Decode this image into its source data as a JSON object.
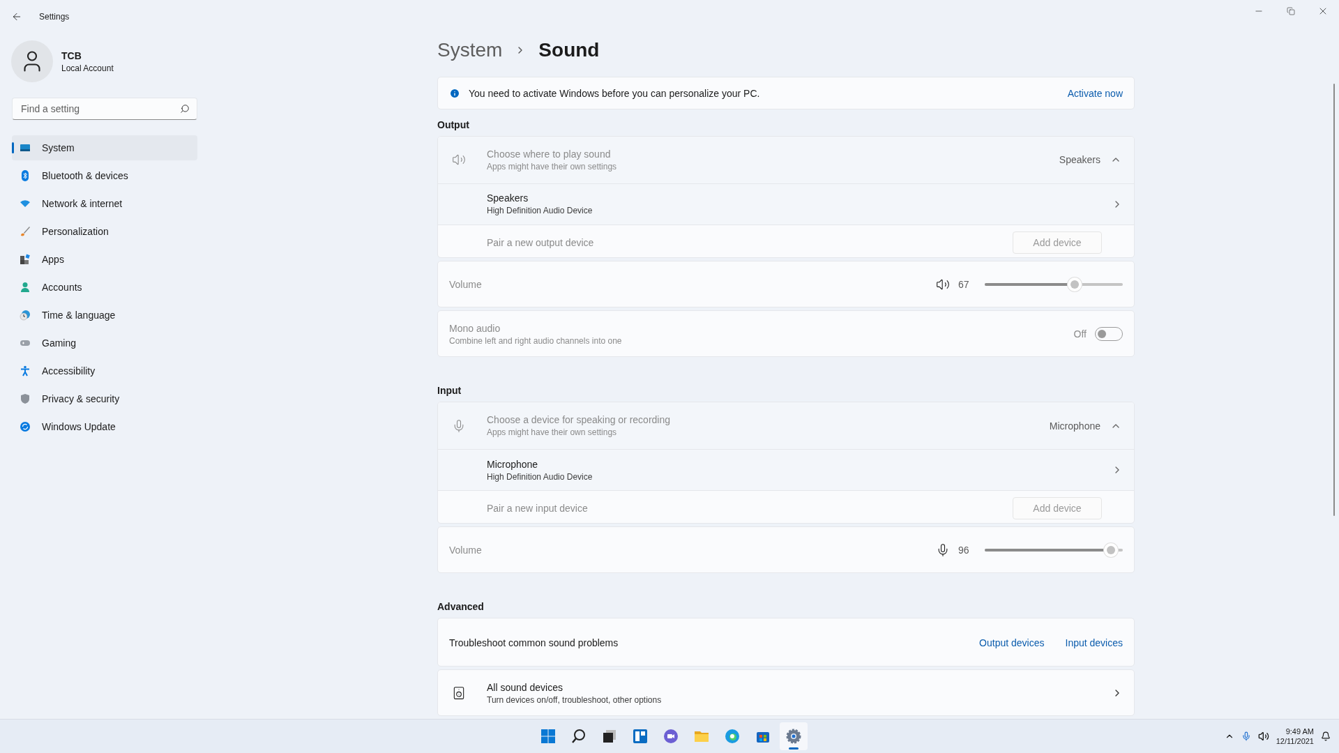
{
  "window": {
    "title": "Settings"
  },
  "account": {
    "name": "TCB",
    "type": "Local Account"
  },
  "search": {
    "placeholder": "Find a setting"
  },
  "nav": [
    {
      "label": "System",
      "kind": "system",
      "selected": true
    },
    {
      "label": "Bluetooth & devices",
      "kind": "bluetooth",
      "selected": false
    },
    {
      "label": "Network & internet",
      "kind": "network",
      "selected": false
    },
    {
      "label": "Personalization",
      "kind": "brush",
      "selected": false
    },
    {
      "label": "Apps",
      "kind": "apps",
      "selected": false
    },
    {
      "label": "Accounts",
      "kind": "accounts",
      "selected": false
    },
    {
      "label": "Time & language",
      "kind": "time",
      "selected": false
    },
    {
      "label": "Gaming",
      "kind": "gaming",
      "selected": false
    },
    {
      "label": "Accessibility",
      "kind": "accessibility",
      "selected": false
    },
    {
      "label": "Privacy & security",
      "kind": "privacy",
      "selected": false
    },
    {
      "label": "Windows Update",
      "kind": "update",
      "selected": false
    }
  ],
  "breadcrumb": [
    "System",
    "Sound"
  ],
  "banner": {
    "message": "You need to activate Windows before you can personalize your PC.",
    "action": "Activate now"
  },
  "sections": [
    {
      "heading": "Output",
      "cards": [
        {
          "kind": "picker",
          "disabled": true,
          "title": "Choose where to play sound",
          "subtitle": "Apps might have their own settings",
          "value": "Speakers",
          "expanded": true,
          "devices": [
            {
              "name": "Speakers",
              "description": "High Definition Audio Device"
            }
          ],
          "pair_label": "Pair a new output device",
          "pair_button": "Add device"
        },
        {
          "kind": "volume",
          "disabled": true,
          "label": "Volume",
          "reading": "67",
          "level": 0.67
        },
        {
          "kind": "toggle",
          "disabled": true,
          "title": "Mono audio",
          "subtitle": "Combine left and right audio channels into one",
          "state_label": "Off",
          "on": false
        }
      ]
    },
    {
      "heading": "Input",
      "cards": [
        {
          "kind": "picker",
          "disabled": true,
          "title": "Choose a device for speaking or recording",
          "subtitle": "Apps might have their own settings",
          "value": "Microphone",
          "expanded": true,
          "devices": [
            {
              "name": "Microphone",
              "description": "High Definition Audio Device"
            }
          ],
          "pair_label": "Pair a new input device",
          "pair_button": "Add device"
        },
        {
          "kind": "volume",
          "disabled": true,
          "label": "Volume",
          "reading": "96",
          "level": 0.96
        }
      ]
    },
    {
      "heading": "Advanced",
      "cards": [
        {
          "kind": "links",
          "disabled": false,
          "title": "Troubleshoot common sound problems",
          "links": [
            "Output devices",
            "Input devices"
          ]
        },
        {
          "kind": "link_row",
          "disabled": false,
          "title": "All sound devices",
          "subtitle": "Turn devices on/off, troubleshoot, other options"
        }
      ]
    }
  ],
  "taskbar": {
    "apps": [
      {
        "kind": "start",
        "selected": false
      },
      {
        "kind": "search",
        "selected": false
      },
      {
        "kind": "taskview",
        "selected": false
      },
      {
        "kind": "widgets",
        "selected": false
      },
      {
        "kind": "chat",
        "selected": false
      },
      {
        "kind": "explorer",
        "selected": false
      },
      {
        "kind": "edge",
        "selected": false
      },
      {
        "kind": "store",
        "selected": false
      },
      {
        "kind": "settings",
        "selected": true
      }
    ],
    "time": "9:49 AM",
    "date": "12/11/2021"
  }
}
